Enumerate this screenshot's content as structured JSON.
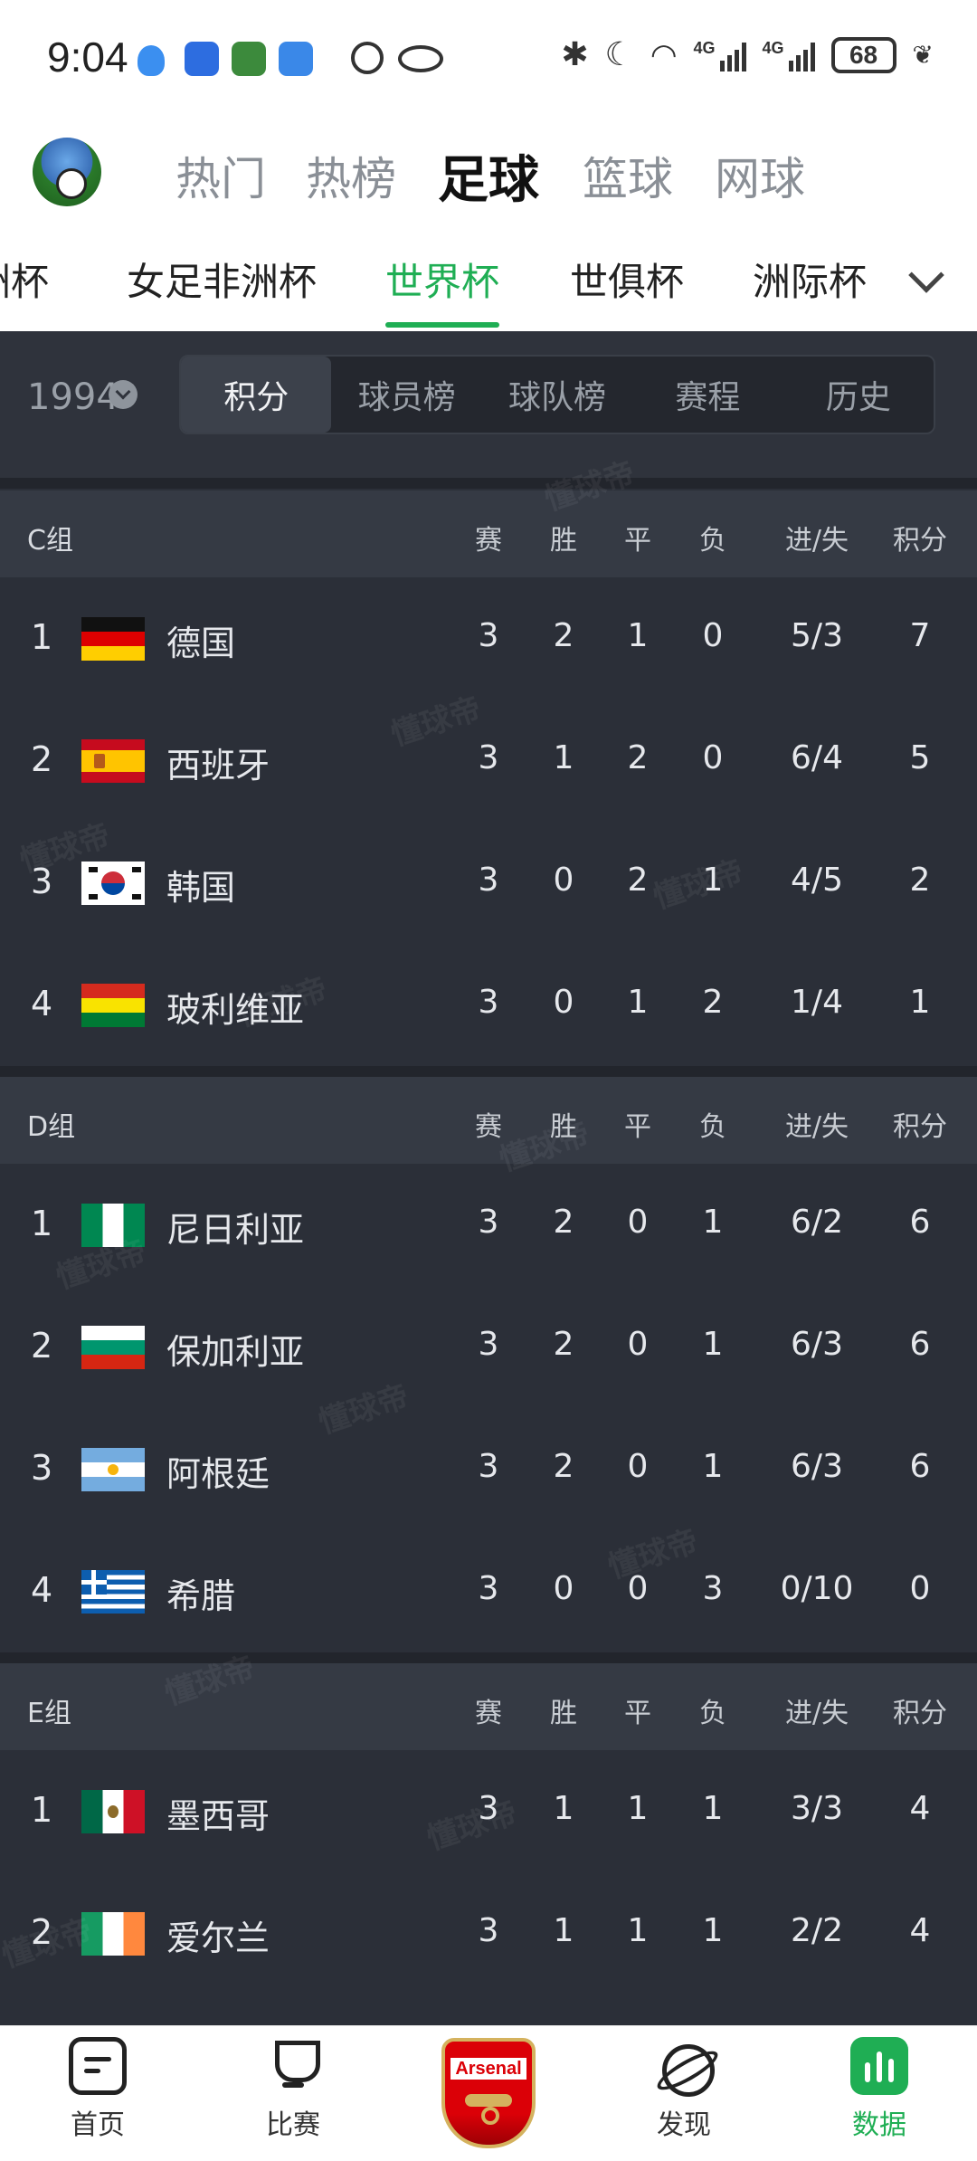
{
  "status_bar": {
    "time": "9:04",
    "battery": "68"
  },
  "top_nav": [
    "热门",
    "热榜",
    "足球",
    "篮球",
    "网球"
  ],
  "top_nav_active": 2,
  "competition_tabs": [
    "洲杯",
    "女足非洲杯",
    "世界杯",
    "世俱杯",
    "洲际杯"
  ],
  "competition_active": 2,
  "filter": {
    "year": "1994",
    "segments": [
      "积分",
      "球员榜",
      "球队榜",
      "赛程",
      "历史"
    ],
    "active_segment": 0
  },
  "columns": [
    "赛",
    "胜",
    "平",
    "负",
    "进/失",
    "积分"
  ],
  "groups": [
    {
      "name": "C组",
      "teams": [
        {
          "rank": "1",
          "flag": "germany",
          "name": "德国",
          "played": "3",
          "win": "2",
          "draw": "1",
          "loss": "0",
          "goals": "5/3",
          "points": "7"
        },
        {
          "rank": "2",
          "flag": "spain",
          "name": "西班牙",
          "played": "3",
          "win": "1",
          "draw": "2",
          "loss": "0",
          "goals": "6/4",
          "points": "5"
        },
        {
          "rank": "3",
          "flag": "korea",
          "name": "韩国",
          "played": "3",
          "win": "0",
          "draw": "2",
          "loss": "1",
          "goals": "4/5",
          "points": "2"
        },
        {
          "rank": "4",
          "flag": "bolivia",
          "name": "玻利维亚",
          "played": "3",
          "win": "0",
          "draw": "1",
          "loss": "2",
          "goals": "1/4",
          "points": "1"
        }
      ]
    },
    {
      "name": "D组",
      "teams": [
        {
          "rank": "1",
          "flag": "nigeria",
          "name": "尼日利亚",
          "played": "3",
          "win": "2",
          "draw": "0",
          "loss": "1",
          "goals": "6/2",
          "points": "6"
        },
        {
          "rank": "2",
          "flag": "bulgaria",
          "name": "保加利亚",
          "played": "3",
          "win": "2",
          "draw": "0",
          "loss": "1",
          "goals": "6/3",
          "points": "6"
        },
        {
          "rank": "3",
          "flag": "argentina",
          "name": "阿根廷",
          "played": "3",
          "win": "2",
          "draw": "0",
          "loss": "1",
          "goals": "6/3",
          "points": "6"
        },
        {
          "rank": "4",
          "flag": "greece",
          "name": "希腊",
          "played": "3",
          "win": "0",
          "draw": "0",
          "loss": "3",
          "goals": "0/10",
          "points": "0"
        }
      ]
    },
    {
      "name": "E组",
      "teams": [
        {
          "rank": "1",
          "flag": "mexico",
          "name": "墨西哥",
          "played": "3",
          "win": "1",
          "draw": "1",
          "loss": "1",
          "goals": "3/3",
          "points": "4"
        },
        {
          "rank": "2",
          "flag": "ireland",
          "name": "爱尔兰",
          "played": "3",
          "win": "1",
          "draw": "1",
          "loss": "1",
          "goals": "2/2",
          "points": "4"
        }
      ]
    }
  ],
  "watermark": "懂球帝",
  "bottom_nav": [
    {
      "label": "首页",
      "icon": "home-icon"
    },
    {
      "label": "比赛",
      "icon": "trophy-icon"
    },
    {
      "label": "",
      "icon": "arsenal-crest-icon"
    },
    {
      "label": "发现",
      "icon": "planet-icon"
    },
    {
      "label": "数据",
      "icon": "data-chart-icon"
    }
  ],
  "bottom_nav_active": 4,
  "arsenal_badge_text": "Arsenal",
  "colors": {
    "accent": "#1fae54",
    "background": "#2b2f38",
    "header": "#353a44"
  }
}
